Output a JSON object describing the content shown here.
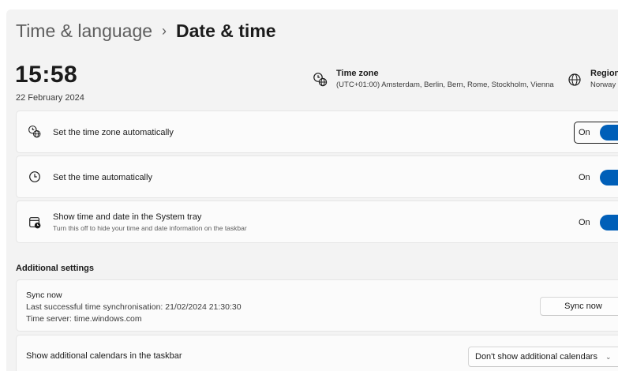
{
  "breadcrumb": {
    "parent": "Time & language",
    "separator": "›",
    "current": "Date & time"
  },
  "clock": {
    "time": "15:58",
    "date": "22 February 2024"
  },
  "timezone": {
    "title": "Time zone",
    "value": "(UTC+01:00) Amsterdam, Berlin, Bern, Rome, Stockholm, Vienna",
    "icon": "timezone-globe-icon"
  },
  "region": {
    "title": "Region",
    "value": "Norway",
    "icon": "globe-icon"
  },
  "settings": [
    {
      "label": "Set the time zone automatically",
      "state": "On",
      "icon": "timezone-globe-icon"
    },
    {
      "label": "Set the time automatically",
      "state": "On",
      "icon": "clock-icon"
    },
    {
      "label": "Show time and date in the System tray",
      "sub": "Turn this off to hide your time and date information on the taskbar",
      "state": "On",
      "icon": "calendar-clock-icon"
    }
  ],
  "additional": {
    "heading": "Additional settings",
    "sync": {
      "title": "Sync now",
      "last_sync": "Last successful time synchronisation: 21/02/2024 21:30:30",
      "server": "Time server: time.windows.com",
      "button": "Sync now"
    },
    "calendars": {
      "label": "Show additional calendars in the taskbar",
      "selected": "Don't show additional calendars"
    }
  },
  "colors": {
    "accent": "#005fb8",
    "background": "#f3f3f3",
    "card": "#fbfbfb"
  }
}
